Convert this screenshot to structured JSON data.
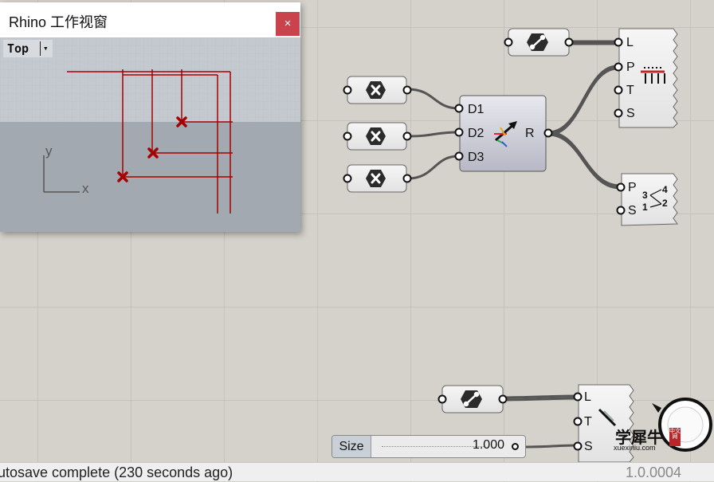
{
  "rhino_viewport": {
    "title": "Rhino 工作视窗",
    "close_glyph": "×",
    "view_name": "Top",
    "view_menu_glyph": "▾",
    "axis_x": "x",
    "axis_y": "y"
  },
  "components": {
    "construct_domain": {
      "inputs": [
        "D1",
        "D2",
        "D3"
      ],
      "output": "R",
      "icon": "domain-arrow-icon"
    },
    "list_item_top": {
      "inputs": [
        "L",
        "P",
        "T",
        "S"
      ],
      "icon": "list-item-icon"
    },
    "sort_list": {
      "inputs": [
        "P",
        "S"
      ],
      "icon": "sort-icon",
      "icon_text": [
        "3",
        "4",
        "1",
        "2"
      ]
    },
    "list_item_bottom": {
      "inputs": [
        "L",
        "T",
        "S"
      ],
      "icon": "list-pointer-icon"
    }
  },
  "slider": {
    "label": "Size",
    "value": "1.000"
  },
  "watermark": {
    "text": "学犀牛",
    "url": "xuexiniu.com",
    "badge": "中文网"
  },
  "status": {
    "message": "utosave complete (230 seconds ago)",
    "version": "1.0.0004"
  },
  "colors": {
    "canvas": "#d5d2cb",
    "component_fill": "#ececec",
    "wire": "#555555",
    "point_marker": "#a40000",
    "close_button": "#c9434d"
  }
}
